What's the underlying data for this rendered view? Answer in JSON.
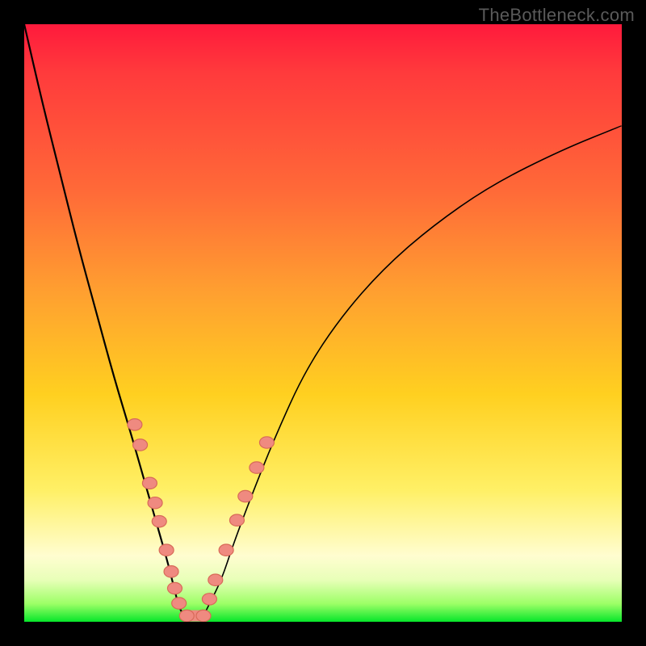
{
  "watermark": "TheBottleneck.com",
  "chart_data": {
    "type": "line",
    "title": "",
    "xlabel": "",
    "ylabel": "",
    "xlim": [
      0,
      100
    ],
    "ylim": [
      0,
      100
    ],
    "grid": false,
    "legend": false,
    "annotations": [],
    "series": [
      {
        "name": "left-branch",
        "x": [
          0,
          3,
          6,
          9,
          12,
          15,
          18,
          20,
          22,
          24,
          25,
          26,
          27
        ],
        "y": [
          100,
          87,
          75,
          63,
          52,
          41,
          31,
          24,
          17,
          10,
          6,
          2,
          1
        ]
      },
      {
        "name": "right-branch",
        "x": [
          30,
          31,
          33,
          35,
          38,
          42,
          47,
          53,
          60,
          68,
          78,
          90,
          100
        ],
        "y": [
          1,
          3,
          7,
          13,
          21,
          31,
          42,
          51,
          59,
          66,
          73,
          79,
          83
        ]
      }
    ],
    "markers": {
      "name": "beads",
      "points": [
        {
          "x": 18.5,
          "y": 33.0
        },
        {
          "x": 19.4,
          "y": 29.6
        },
        {
          "x": 21.0,
          "y": 23.2
        },
        {
          "x": 21.9,
          "y": 19.9
        },
        {
          "x": 22.6,
          "y": 16.8
        },
        {
          "x": 23.8,
          "y": 12.0
        },
        {
          "x": 24.6,
          "y": 8.4
        },
        {
          "x": 25.2,
          "y": 5.6
        },
        {
          "x": 25.9,
          "y": 3.1
        },
        {
          "x": 27.2,
          "y": 1.0
        },
        {
          "x": 30.0,
          "y": 1.0
        },
        {
          "x": 31.0,
          "y": 3.8
        },
        {
          "x": 32.0,
          "y": 7.0
        },
        {
          "x": 33.8,
          "y": 12.0
        },
        {
          "x": 35.6,
          "y": 17.0
        },
        {
          "x": 37.0,
          "y": 21.0
        },
        {
          "x": 38.9,
          "y": 25.8
        },
        {
          "x": 40.6,
          "y": 30.0
        }
      ],
      "bridge": {
        "x1": 27.2,
        "x2": 30.0,
        "y": 1.0
      }
    }
  }
}
